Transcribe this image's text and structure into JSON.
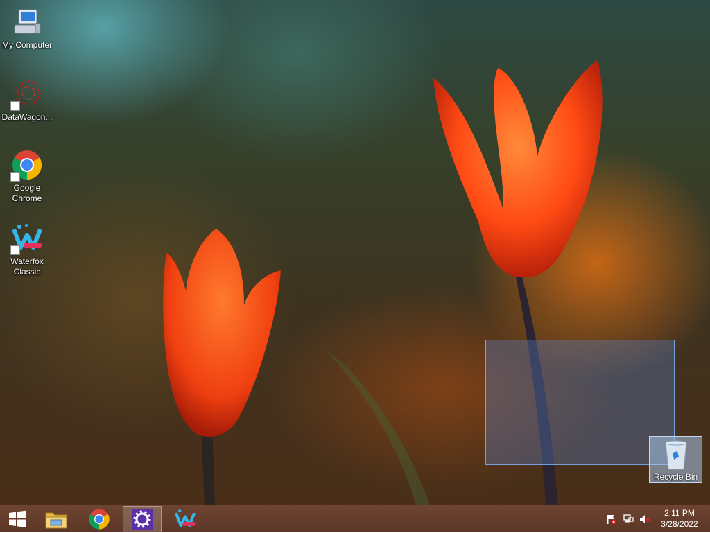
{
  "desktop": {
    "icons": [
      {
        "label": "My Computer",
        "icon": "computer-icon"
      },
      {
        "label": "DataWagon...",
        "icon": "datawagon-icon"
      },
      {
        "label": "Google Chrome",
        "icon": "chrome-icon"
      },
      {
        "label": "Waterfox Classic",
        "icon": "waterfox-icon"
      }
    ],
    "recycle_bin": {
      "label": "Recycle Bin",
      "icon": "recycle-bin-icon"
    }
  },
  "taskbar": {
    "start": {
      "icon": "windows-logo-icon"
    },
    "pinned": [
      {
        "icon": "file-explorer-icon",
        "active": false
      },
      {
        "icon": "chrome-icon",
        "active": false
      },
      {
        "icon": "settings-gear-icon",
        "active": true
      },
      {
        "icon": "waterfox-icon",
        "active": false
      }
    ],
    "tray": {
      "icons": [
        "action-center-flag-icon",
        "network-icon",
        "volume-muted-icon"
      ],
      "time": "2:11 PM",
      "date": "3/28/2022"
    }
  },
  "colors": {
    "taskbar": "#6e4431",
    "selection": "#5a82c8",
    "settings_tile": "#5b2fa6"
  }
}
